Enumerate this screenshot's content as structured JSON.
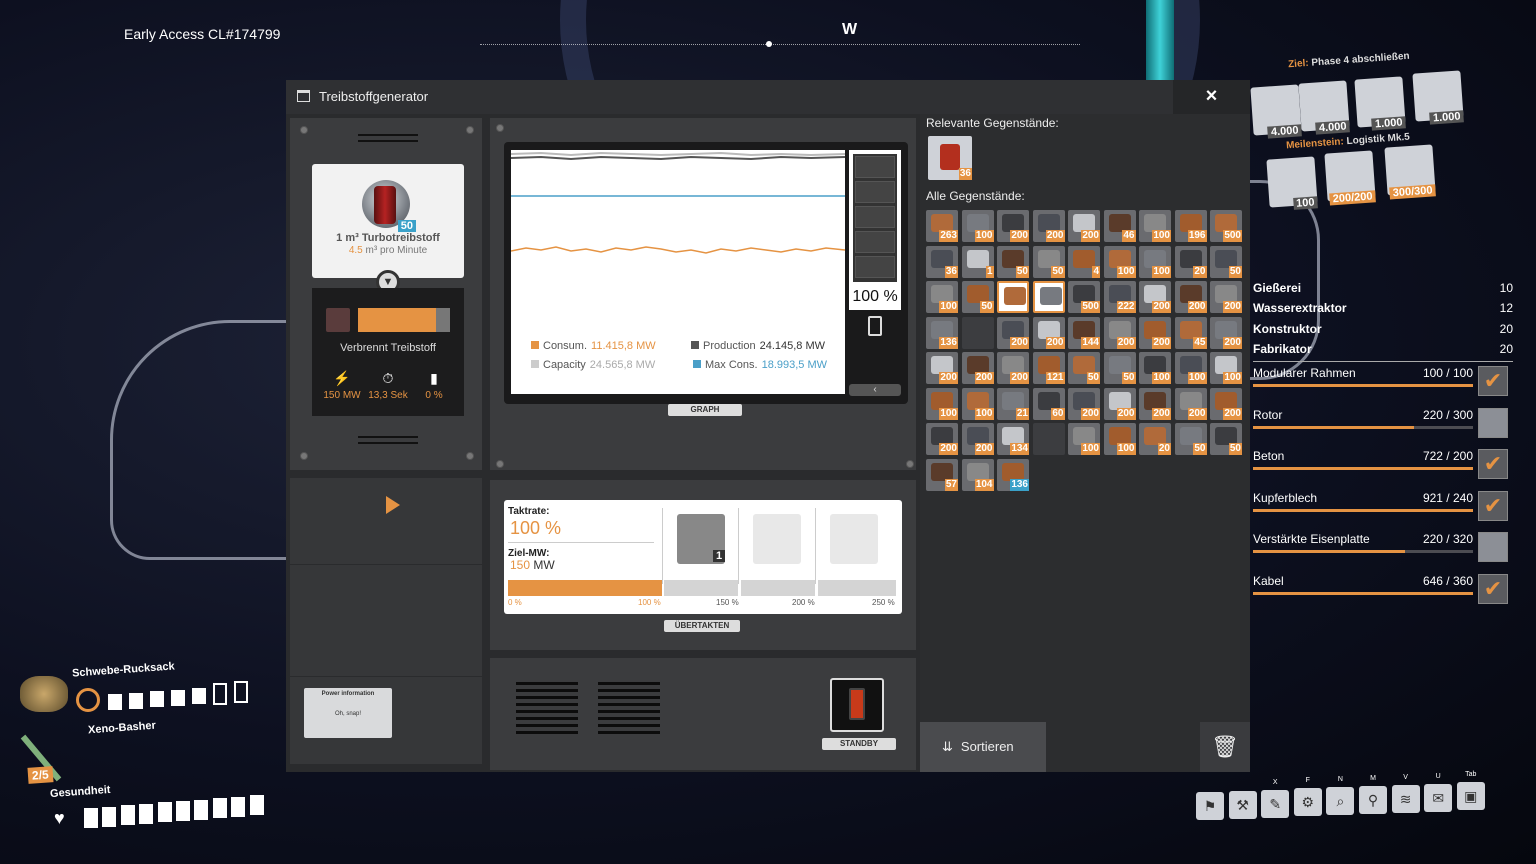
{
  "build_label": "Early Access CL#174799",
  "compass_direction": "W",
  "window": {
    "title": "Treibstoffgenerator",
    "close_icon": "×"
  },
  "fuel": {
    "name": "1 m³ Turbotreibstoff",
    "rate_value": "4.5",
    "rate_unit": "m³ pro Minute",
    "count": "50",
    "burn_label": "Verbrennt Treibstoff",
    "burn_progress": 0.85,
    "stats": [
      {
        "icon": "lightning-icon",
        "glyph": "⚡",
        "value": "150 MW"
      },
      {
        "icon": "stopwatch-icon",
        "glyph": "⏱",
        "value": "13,3 Sek"
      },
      {
        "icon": "bar-chart-icon",
        "glyph": "▮",
        "value": "0 %"
      }
    ]
  },
  "graph": {
    "legend": {
      "consum_label": "Consum.",
      "consum_value": "11.415,8 MW",
      "production_label": "Production",
      "production_value": "24.145,8 MW",
      "capacity_label": "Capacity",
      "capacity_value": "24.565,8 MW",
      "maxcons_label": "Max Cons.",
      "maxcons_value": "18.993,5 MW"
    },
    "gauge_percent": "100 %",
    "collapse_glyph": "‹",
    "tab_label": "GRAPH"
  },
  "overclock": {
    "taktrate_label": "Taktrate:",
    "taktrate_value": "100 %",
    "ziel_label": "Ziel-MW:",
    "ziel_value": "150",
    "ziel_unit": "MW",
    "slot_count": "1",
    "ticks": [
      "0 %",
      "100 %",
      "150 %",
      "200 %",
      "250 %"
    ],
    "apply_label": "ÜBERTAKTEN"
  },
  "standby_label": "STANDBY",
  "power_info_card": {
    "title": "Power information",
    "note": "Oh, snap!"
  },
  "inventory": {
    "relevant_heading": "Relevante Gegenstände:",
    "relevant_count": "36",
    "all_heading": "Alle Gegenstände:",
    "rows": [
      [
        "263",
        "100",
        "200",
        "200",
        "200",
        "46",
        "100",
        "196",
        "500"
      ],
      [
        "36",
        "1",
        "50",
        "50",
        "4",
        "100",
        "100",
        "20",
        "50"
      ],
      [
        "100",
        "50",
        "",
        "",
        "500",
        "222",
        "200",
        "200",
        "200"
      ],
      [
        "136",
        "",
        "200",
        "200",
        "144",
        "200",
        "200",
        "45",
        "200"
      ],
      [
        "200",
        "200",
        "200",
        "121",
        "50",
        "50",
        "100",
        "100",
        "100"
      ],
      [
        "100",
        "100",
        "21",
        "60",
        "200",
        "200",
        "200",
        "200",
        "200"
      ],
      [
        "200",
        "200",
        "134",
        "",
        "100",
        "100",
        "20",
        "50",
        "50"
      ],
      [
        "57",
        "104",
        "136"
      ]
    ],
    "sort_label": "Sortieren",
    "trash_icon": "🗑"
  },
  "hud_goal": {
    "goal_label": "Ziel:",
    "goal_text": "Phase 4 abschließen",
    "goal_items": [
      "4.000",
      "4.000",
      "1.000",
      "1.000"
    ],
    "milestone_label": "Meilenstein:",
    "milestone_text": "Logistik Mk.5",
    "milestone_items": [
      "100",
      "200/200",
      "300/300"
    ]
  },
  "buildings": [
    {
      "name": "Gießerei",
      "count": "10"
    },
    {
      "name": "Wasserextraktor",
      "count": "12"
    },
    {
      "name": "Konstruktor",
      "count": "20"
    },
    {
      "name": "Fabrikator",
      "count": "20"
    }
  ],
  "requirements": [
    {
      "name": "Modularer Rahmen",
      "value": "100 / 100",
      "progress": 1.0,
      "done": true
    },
    {
      "name": "Rotor",
      "value": "220 / 300",
      "progress": 0.73,
      "done": false
    },
    {
      "name": "Beton",
      "value": "722 / 200",
      "progress": 1.0,
      "done": true
    },
    {
      "name": "Kupferblech",
      "value": "921 / 240",
      "progress": 1.0,
      "done": true
    },
    {
      "name": "Verstärkte Eisenplatte",
      "value": "220 / 320",
      "progress": 0.69,
      "done": false
    },
    {
      "name": "Kabel",
      "value": "646 / 360",
      "progress": 1.0,
      "done": true
    }
  ],
  "check_glyph": "✔",
  "hud_left": {
    "backpack_label": "Schwebe-Rucksack",
    "weapon_label": "Xeno-Basher",
    "slot_badge": "2/5",
    "health_label": "Gesundheit"
  },
  "toolbar_keys": [
    "X",
    "F",
    "N",
    "M",
    "V",
    "U",
    "Tab"
  ],
  "colors": {
    "accent": "#e59343",
    "blue": "#3aa1c9"
  }
}
